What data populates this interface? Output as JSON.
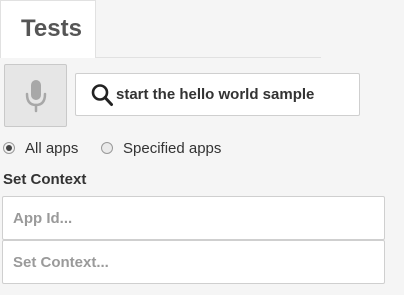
{
  "tabs": [
    {
      "label": "Tests",
      "active": true
    }
  ],
  "voice": {
    "icon": "microphone-icon"
  },
  "search": {
    "icon": "search-icon",
    "value": "start the hello world sample"
  },
  "scope": {
    "options": [
      {
        "label": "All apps",
        "selected": true
      },
      {
        "label": "Specified apps",
        "selected": false
      }
    ]
  },
  "context": {
    "title": "Set Context",
    "app_id_placeholder": "App Id...",
    "set_context_placeholder": "Set Context..."
  },
  "colors": {
    "background": "#f5f5f5",
    "mic_button": "#e6e6e6",
    "icon_gray": "#a8a8a8"
  }
}
